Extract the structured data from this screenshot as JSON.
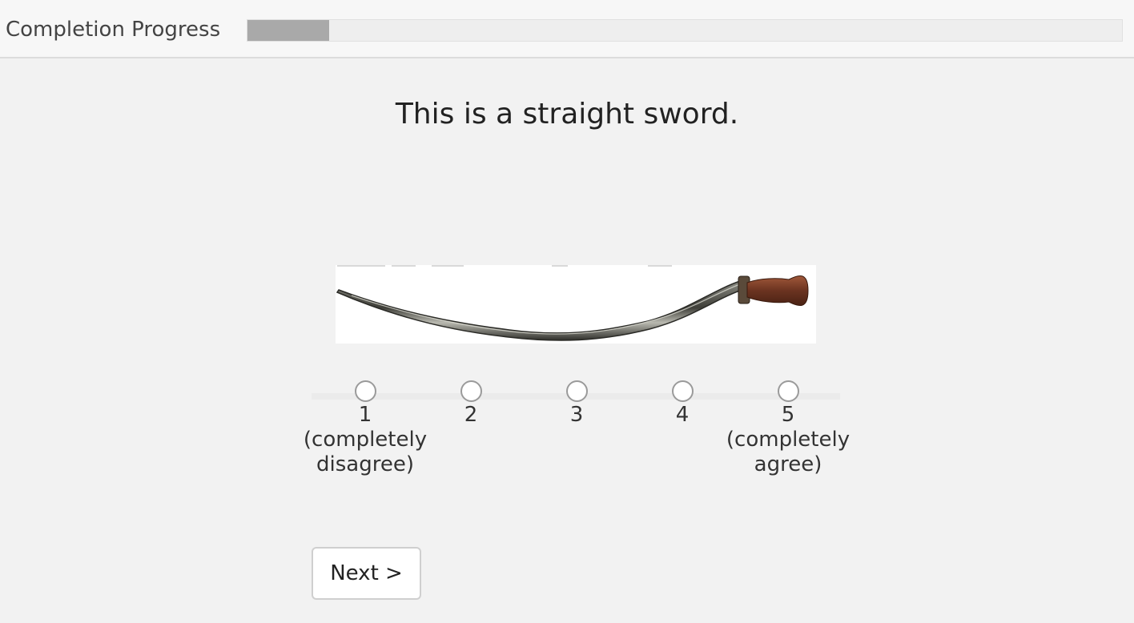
{
  "header": {
    "progress_label": "Completion Progress",
    "progress_fraction": 0.093
  },
  "question": {
    "text": "This is a straight sword."
  },
  "image": {
    "subject": "curved-sword-image"
  },
  "scale": {
    "options": [
      {
        "value": "1",
        "description": "(completely\ndisagree)"
      },
      {
        "value": "2",
        "description": ""
      },
      {
        "value": "3",
        "description": ""
      },
      {
        "value": "4",
        "description": ""
      },
      {
        "value": "5",
        "description": "(completely\nagree)"
      }
    ]
  },
  "navigation": {
    "next_label": "Next >"
  },
  "colors": {
    "background": "#f2f2f2",
    "progress_fill": "#a9a9a9",
    "progress_track": "#eeeeee"
  }
}
